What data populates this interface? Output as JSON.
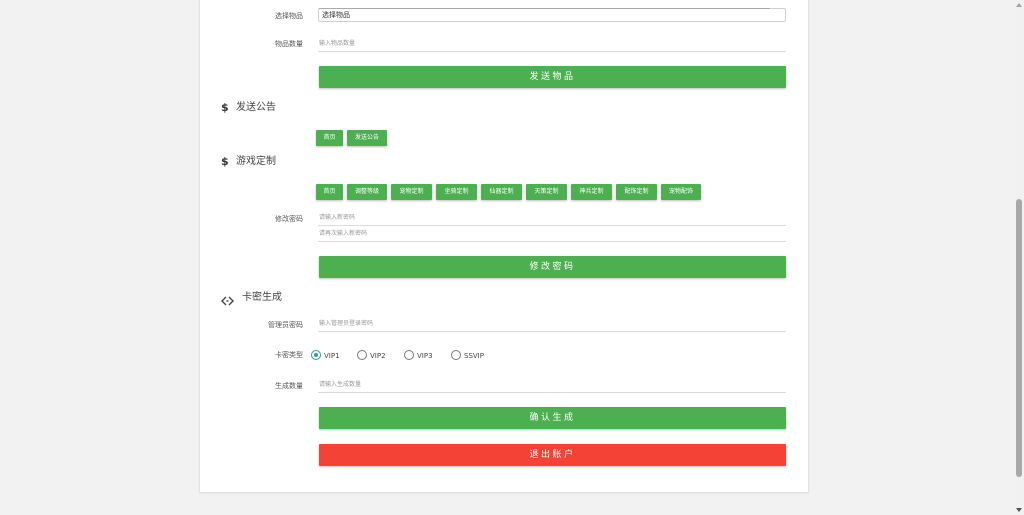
{
  "item_section": {
    "select_label": "选择物品",
    "select_value": "选择物品",
    "quantity_label": "物品数量",
    "quantity_placeholder": "输入物品数量",
    "submit_label": "发送物品"
  },
  "announce_section": {
    "icon": "dollar-icon",
    "title": "发送公告",
    "buttons": [
      "首页",
      "发送公告"
    ]
  },
  "game_section": {
    "icon": "dollar-icon",
    "title": "游戏定制",
    "buttons": [
      "首页",
      "调整等级",
      "宠物定制",
      "坐骑定制",
      "仙器定制",
      "天策定制",
      "神兵定制",
      "配饰定制",
      "宠物配饰"
    ],
    "password_label": "修改密码",
    "new_password_placeholder": "请输入新密码",
    "confirm_password_placeholder": "请再次输入新密码",
    "submit_label": "修改密码"
  },
  "card_section": {
    "icon": "code-icon",
    "title": "卡密生成",
    "admin_label": "管理员密码",
    "admin_placeholder": "输入管理员登录密码",
    "type_label": "卡密类型",
    "types": [
      "VIP1",
      "VIP2",
      "VIP3",
      "SSVIP"
    ],
    "selected_type": "VIP1",
    "count_label": "生成数量",
    "count_placeholder": "请输入生成数量",
    "submit_label": "确认生成",
    "logout_label": "退出账户"
  },
  "colors": {
    "primary_green": "#4caf50",
    "danger_red": "#f44336",
    "radio_teal": "#26a69a"
  }
}
